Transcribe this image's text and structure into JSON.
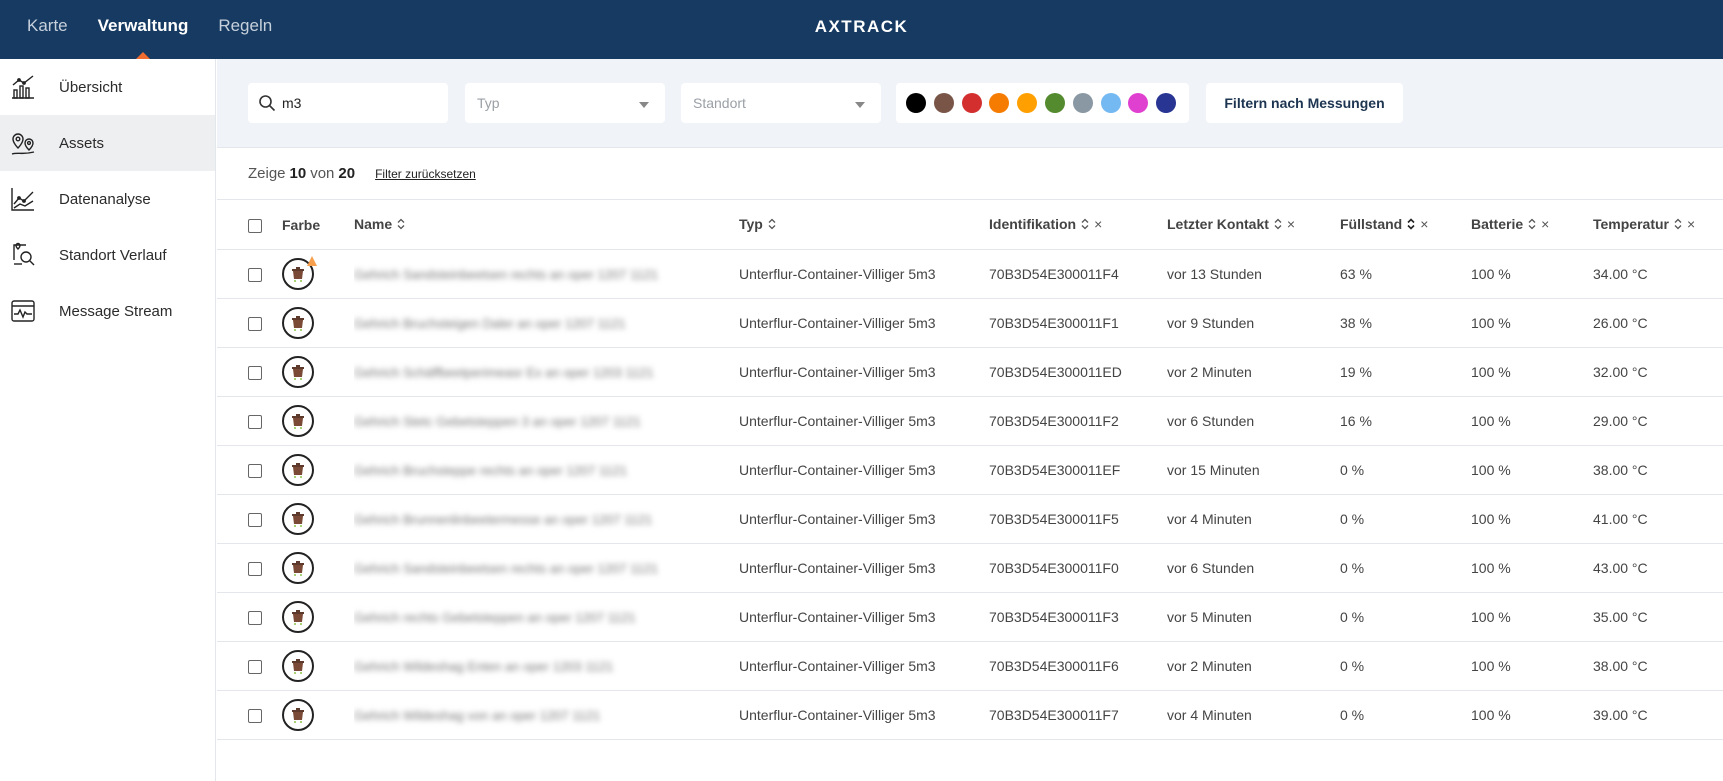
{
  "nav": {
    "items": [
      {
        "label": "Karte",
        "active": false
      },
      {
        "label": "Verwaltung",
        "active": true
      },
      {
        "label": "Regeln",
        "active": false
      }
    ],
    "brand": "AXTRACK"
  },
  "sidebar": {
    "items": [
      {
        "label": "Übersicht",
        "icon": "bar-chart-icon",
        "active": false
      },
      {
        "label": "Assets",
        "icon": "location-pins-icon",
        "active": true
      },
      {
        "label": "Datenanalyse",
        "icon": "line-chart-icon",
        "active": false
      },
      {
        "label": "Standort Verlauf",
        "icon": "location-search-icon",
        "active": false
      },
      {
        "label": "Message Stream",
        "icon": "pulse-monitor-icon",
        "active": false
      }
    ]
  },
  "filters": {
    "search_value": "m3",
    "type_placeholder": "Typ",
    "location_placeholder": "Standort",
    "colors": [
      "#000000",
      "#795548",
      "#d32f2f",
      "#f57c00",
      "#ffa000",
      "#558b2f",
      "#8a98a4",
      "#74b9f2",
      "#e040d0",
      "#283593"
    ],
    "measure_button": "Filtern nach Messungen"
  },
  "summary": {
    "prefix": "Zeige",
    "shown": "10",
    "middle": "von",
    "total": "20",
    "reset_label": "Filter zurücksetzen"
  },
  "table": {
    "headers": {
      "color": "Farbe",
      "name": "Name",
      "type": "Typ",
      "ident": "Identifikation",
      "contact": "Letzter Kontakt",
      "fill": "Füllstand",
      "battery": "Batterie",
      "temp": "Temperatur"
    },
    "rows": [
      {
        "name": "Gehrich Sandsteinbeetsen rechts an oper 1207 1121",
        "type": "Unterflur-Container-Villiger 5m3",
        "ident": "70B3D54E300011F4",
        "contact": "vor 13 Stunden",
        "fill": "63 %",
        "battery": "100 %",
        "temp": "34.00 °C",
        "warning": true
      },
      {
        "name": "Gehrich Bruchsteigen Daler an oper 1207 1121",
        "type": "Unterflur-Container-Villiger 5m3",
        "ident": "70B3D54E300011F1",
        "contact": "vor 9 Stunden",
        "fill": "38 %",
        "battery": "100 %",
        "temp": "26.00 °C",
        "warning": false
      },
      {
        "name": "Gehrich Schäffbeetperimeasr Ex an oper 1203 1121",
        "type": "Unterflur-Container-Villiger 5m3",
        "ident": "70B3D54E300011ED",
        "contact": "vor 2 Minuten",
        "fill": "19 %",
        "battery": "100 %",
        "temp": "32.00 °C",
        "warning": false
      },
      {
        "name": "Gehrich Stetc Gebetsteppen 3 an oper 1207 1121",
        "type": "Unterflur-Container-Villiger 5m3",
        "ident": "70B3D54E300011F2",
        "contact": "vor 6 Stunden",
        "fill": "16 %",
        "battery": "100 %",
        "temp": "29.00 °C",
        "warning": false
      },
      {
        "name": "Gehrich Bruchsteppe rechts an oper 1207 1121",
        "type": "Unterflur-Container-Villiger 5m3",
        "ident": "70B3D54E300011EF",
        "contact": "vor 15 Minuten",
        "fill": "0 %",
        "battery": "100 %",
        "temp": "38.00 °C",
        "warning": false
      },
      {
        "name": "Gehrich Brunnenlinbeetermesse an oper 1207 1121",
        "type": "Unterflur-Container-Villiger 5m3",
        "ident": "70B3D54E300011F5",
        "contact": "vor 4 Minuten",
        "fill": "0 %",
        "battery": "100 %",
        "temp": "41.00 °C",
        "warning": false
      },
      {
        "name": "Gehrich Sandsteinbeetsen rechts an oper 1207 1121",
        "type": "Unterflur-Container-Villiger 5m3",
        "ident": "70B3D54E300011F0",
        "contact": "vor 6 Stunden",
        "fill": "0 %",
        "battery": "100 %",
        "temp": "43.00 °C",
        "warning": false
      },
      {
        "name": "Gehrich rechts Gebetsteppen an oper 1207 1121",
        "type": "Unterflur-Container-Villiger 5m3",
        "ident": "70B3D54E300011F3",
        "contact": "vor 5 Minuten",
        "fill": "0 %",
        "battery": "100 %",
        "temp": "35.00 °C",
        "warning": false
      },
      {
        "name": "Gehrich Wildeshag Enten an oper 1203 1121",
        "type": "Unterflur-Container-Villiger 5m3",
        "ident": "70B3D54E300011F6",
        "contact": "vor 2 Minuten",
        "fill": "0 %",
        "battery": "100 %",
        "temp": "38.00 °C",
        "warning": false
      },
      {
        "name": "Gehrich Wildeshag von an oper 1207 1121",
        "type": "Unterflur-Container-Villiger 5m3",
        "ident": "70B3D54E300011F7",
        "contact": "vor 4 Minuten",
        "fill": "0 %",
        "battery": "100 %",
        "temp": "39.00 °C",
        "warning": false
      }
    ]
  }
}
